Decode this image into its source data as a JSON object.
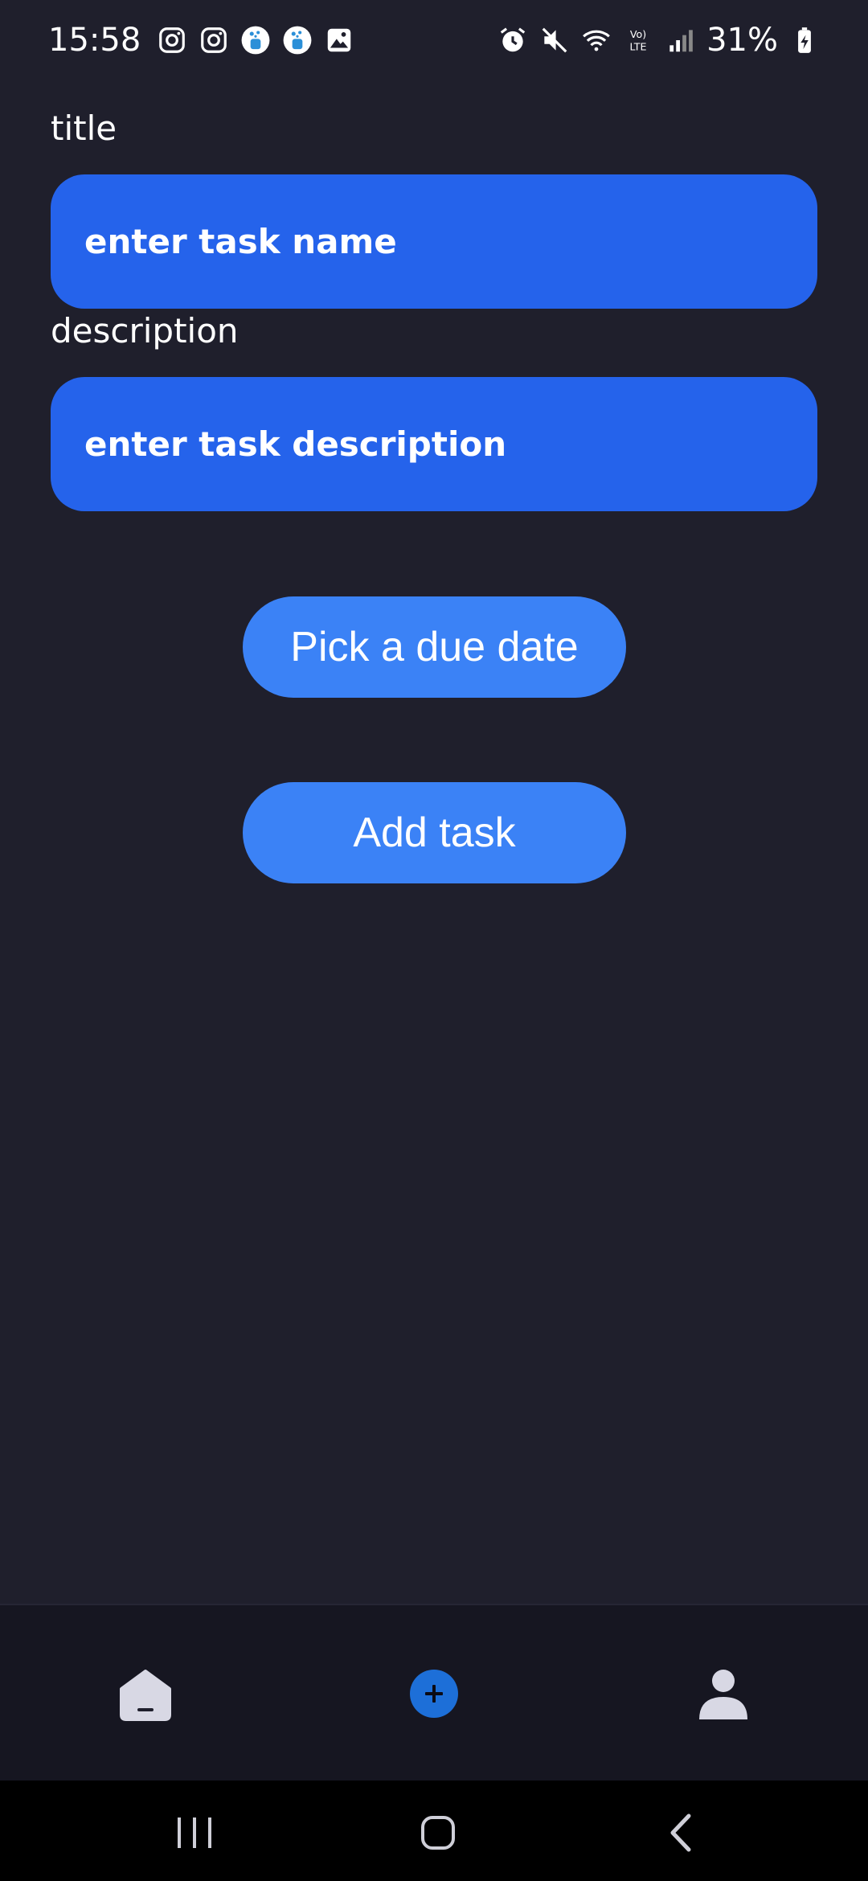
{
  "status_bar": {
    "time": "15:58",
    "battery_percent": "31%",
    "left_icons": [
      "instagram-icon",
      "instagram-icon",
      "app-notification-icon",
      "app-notification-icon",
      "gallery-icon"
    ],
    "right_icons": [
      "alarm-icon",
      "mute-icon",
      "wifi-icon",
      "volte-icon",
      "signal-icon",
      "battery-charging-icon"
    ]
  },
  "form": {
    "title_label": "title",
    "title_placeholder": "enter task name",
    "description_label": "description",
    "description_placeholder": "enter task description",
    "due_date_button": "Pick a due date",
    "add_task_button": "Add task"
  },
  "bottom_nav": {
    "items": [
      {
        "icon": "home-icon"
      },
      {
        "icon": "add-circle-icon"
      },
      {
        "icon": "profile-icon"
      }
    ]
  },
  "colors": {
    "background": "#1f1f2c",
    "input_fill": "#2563eb",
    "button_fill": "#3b82f6",
    "nav_background": "#161621"
  }
}
